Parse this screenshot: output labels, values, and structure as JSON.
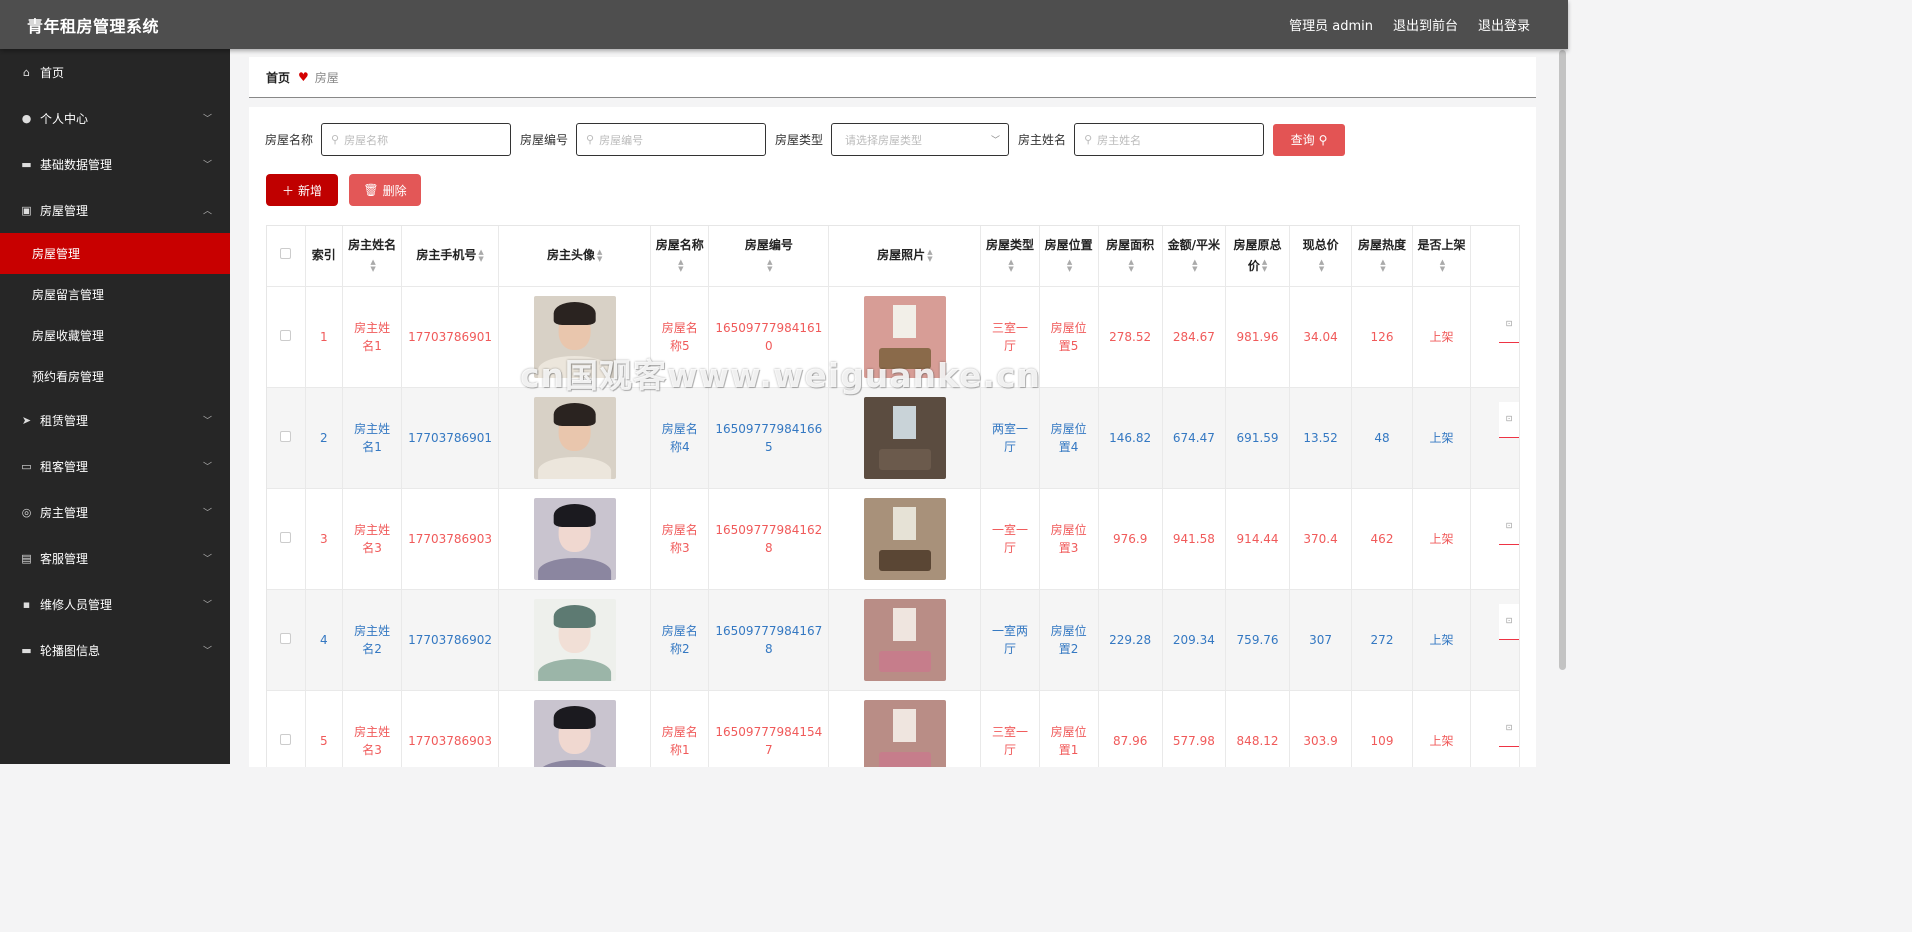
{
  "app": {
    "title": "青年租房管理系统",
    "admin_label": "管理员 admin",
    "back_front": "退出到前台",
    "logout": "退出登录"
  },
  "sidebar": {
    "items": [
      {
        "label": "首页",
        "icon": "home-icon",
        "expand": false
      },
      {
        "label": "个人中心",
        "icon": "user-icon",
        "expand": true
      },
      {
        "label": "基础数据管理",
        "icon": "database-icon",
        "expand": true
      },
      {
        "label": "房屋管理",
        "icon": "house-icon",
        "expand": true,
        "open": true
      },
      {
        "label": "租赁管理",
        "icon": "send-icon",
        "expand": true
      },
      {
        "label": "租客管理",
        "icon": "monitor-icon",
        "expand": true
      },
      {
        "label": "房主管理",
        "icon": "target-icon",
        "expand": true
      },
      {
        "label": "客服管理",
        "icon": "clipboard-icon",
        "expand": true
      },
      {
        "label": "维修人员管理",
        "icon": "chat-icon",
        "expand": true
      },
      {
        "label": "轮播图信息",
        "icon": "image-icon",
        "expand": true
      }
    ],
    "sub_items": [
      "房屋管理",
      "房屋留言管理",
      "房屋收藏管理",
      "预约看房管理"
    ]
  },
  "breadcrumb": {
    "home": "首页",
    "current": "房屋"
  },
  "search": {
    "name_label": "房屋名称",
    "name_placeholder": "房屋名称",
    "code_label": "房屋编号",
    "code_placeholder": "房屋编号",
    "type_label": "房屋类型",
    "type_placeholder": "请选择房屋类型",
    "owner_label": "房主姓名",
    "owner_placeholder": "房主姓名",
    "query_button": "查询"
  },
  "actions": {
    "add": "新增",
    "delete": "删除"
  },
  "table": {
    "headers": {
      "index": "索引",
      "owner": "房主姓名",
      "phone": "房主手机号",
      "avatar": "房主头像",
      "name": "房屋名称",
      "code": "房屋编号",
      "photo": "房屋照片",
      "type": "房屋类型",
      "location": "房屋位置",
      "area": "房屋面积",
      "unit_price": "金额/平米",
      "orig_price": "房屋原总价",
      "cur_price": "现总价",
      "heat": "房屋热度",
      "listed": "是否上架"
    },
    "rows": [
      {
        "index": "1",
        "owner": "房主姓名1",
        "phone": "17703786901",
        "name": "房屋名称5",
        "code": "16509777984161 0",
        "type": "三室一厅",
        "location": "房屋位置5",
        "area": "278.52",
        "unit_price": "284.67",
        "orig_price": "981.96",
        "cur_price": "34.04",
        "heat": "126",
        "listed": "上架"
      },
      {
        "index": "2",
        "owner": "房主姓名1",
        "phone": "17703786901",
        "name": "房屋名称4",
        "code": "16509777984166 5",
        "type": "两室一厅",
        "location": "房屋位置4",
        "area": "146.82",
        "unit_price": "674.47",
        "orig_price": "691.59",
        "cur_price": "13.52",
        "heat": "48",
        "listed": "上架"
      },
      {
        "index": "3",
        "owner": "房主姓名3",
        "phone": "17703786903",
        "name": "房屋名称3",
        "code": "16509777984162 8",
        "type": "一室一厅",
        "location": "房屋位置3",
        "area": "976.9",
        "unit_price": "941.58",
        "orig_price": "914.44",
        "cur_price": "370.4",
        "heat": "462",
        "listed": "上架"
      },
      {
        "index": "4",
        "owner": "房主姓名2",
        "phone": "17703786902",
        "name": "房屋名称2",
        "code": "16509777984167 8",
        "type": "一室两厅",
        "location": "房屋位置2",
        "area": "229.28",
        "unit_price": "209.34",
        "orig_price": "759.76",
        "cur_price": "307",
        "heat": "272",
        "listed": "上架"
      },
      {
        "index": "5",
        "owner": "房主姓名3",
        "phone": "17703786903",
        "name": "房屋名称1",
        "code": "16509777984154 7",
        "type": "三室一厅",
        "location": "房屋位置1",
        "area": "87.96",
        "unit_price": "577.98",
        "orig_price": "848.12",
        "cur_price": "303.9",
        "heat": "109",
        "listed": "上架"
      }
    ]
  },
  "watermark": "cn国观客www.weiguanke.cn",
  "colors": {
    "accent": "#c80000",
    "odd_text": "#f05a5a",
    "even_text": "#3478c2",
    "topbar": "#4e4e4e",
    "sidebar": "#262626"
  }
}
